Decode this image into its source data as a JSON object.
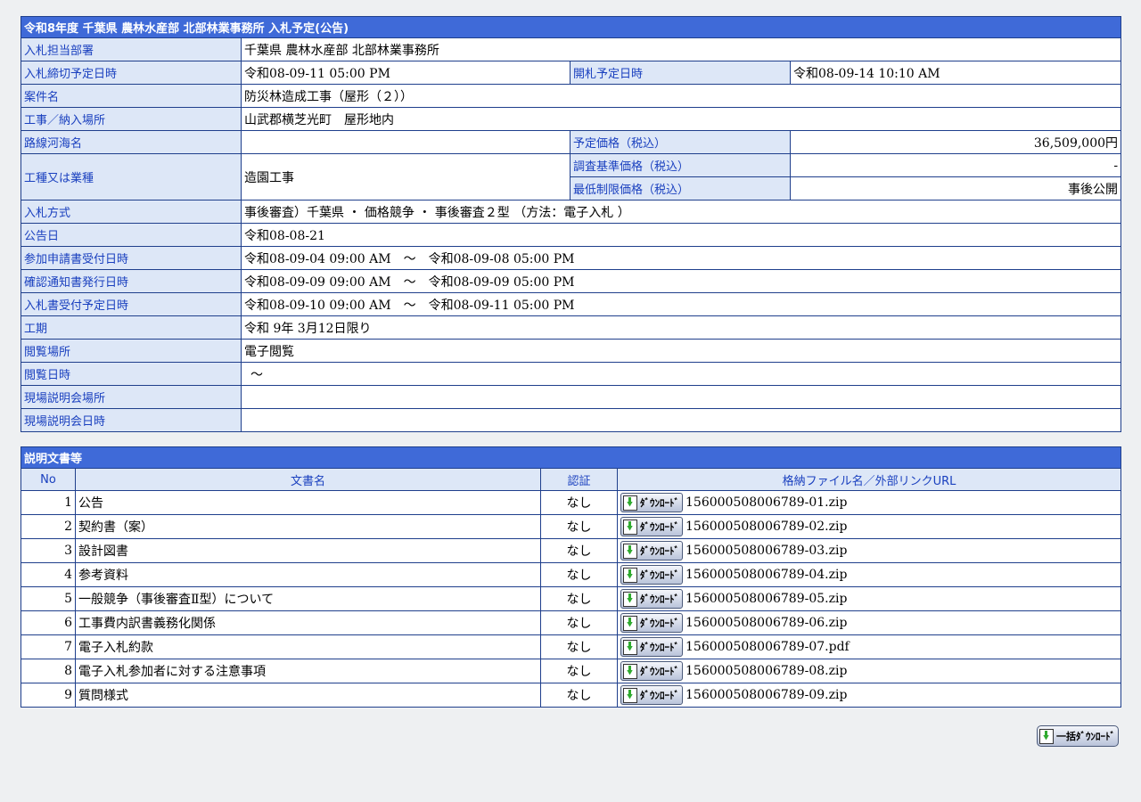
{
  "title": "令和8年度 千葉県 農林水産部 北部林業事務所 入札予定(公告)",
  "info": {
    "dept_label": "入札担当部署",
    "dept": "千葉県 農林水産部 北部林業事務所",
    "deadline_label": "入札締切予定日時",
    "deadline": "令和08-09-11 05:00 PM",
    "opening_label": "開札予定日時",
    "opening": "令和08-09-14 10:10 AM",
    "case_label": "案件名",
    "case": "防災林造成工事（屋形（２））",
    "place_label": "工事／納入場所",
    "place": "山武郡横芝光町　屋形地内",
    "route_label": "路線河海名",
    "route": "",
    "est_price_label": "予定価格（税込）",
    "est_price": "36,509,000円",
    "type_label": "工種又は業種",
    "type": "造園工事",
    "survey_price_label": "調査基準価格（税込）",
    "survey_price": "-",
    "min_price_label": "最低制限価格（税込）",
    "min_price": "事後公開",
    "method_label": "入札方式",
    "method": "事後審査）千葉県 ・ 価格競争 ・ 事後審査２型 （方法：電子入札 ）",
    "notice_label": "公告日",
    "notice": "令和08-08-21",
    "apply_label": "参加申請書受付日時",
    "apply": "令和08-09-04 09:00 AM　～　令和08-09-08 05:00 PM",
    "confirm_label": "確認通知書発行日時",
    "confirm": "令和08-09-09 09:00 AM　～　令和08-09-09 05:00 PM",
    "receive_label": "入札書受付予定日時",
    "receive": "令和08-09-10 09:00 AM　～　令和08-09-11 05:00 PM",
    "period_label": "工期",
    "period": "令和 9年 3月12日限り",
    "view_place_label": "閲覧場所",
    "view_place": "電子閲覧",
    "view_date_label": "閲覧日時",
    "view_date": "～",
    "site_place_label": "現場説明会場所",
    "site_place": "",
    "site_date_label": "現場説明会日時",
    "site_date": ""
  },
  "docs": {
    "title": "説明文書等",
    "headers": {
      "no": "No",
      "name": "文書名",
      "auth": "認証",
      "file": "格納ファイル名／外部リンクURL"
    },
    "download_label": "ﾀﾞｳﾝﾛｰﾄﾞ",
    "rows": [
      {
        "no": "1",
        "name": "公告",
        "auth": "なし",
        "file": "156000508006789-01.zip"
      },
      {
        "no": "2",
        "name": "契約書（案）",
        "auth": "なし",
        "file": "156000508006789-02.zip"
      },
      {
        "no": "3",
        "name": "設計図書",
        "auth": "なし",
        "file": "156000508006789-03.zip"
      },
      {
        "no": "4",
        "name": "参考資料",
        "auth": "なし",
        "file": "156000508006789-04.zip"
      },
      {
        "no": "5",
        "name": "一般競争（事後審査Ⅱ型）について",
        "auth": "なし",
        "file": "156000508006789-05.zip"
      },
      {
        "no": "6",
        "name": "工事費内訳書義務化関係",
        "auth": "なし",
        "file": "156000508006789-06.zip"
      },
      {
        "no": "7",
        "name": "電子入札約款",
        "auth": "なし",
        "file": "156000508006789-07.pdf"
      },
      {
        "no": "8",
        "name": "電子入札参加者に対する注意事項",
        "auth": "なし",
        "file": "156000508006789-08.zip"
      },
      {
        "no": "9",
        "name": "質問様式",
        "auth": "なし",
        "file": "156000508006789-09.zip"
      }
    ]
  },
  "bulk_download_label": "一括ﾀﾞｳﾝﾛｰﾄﾞ",
  "icons": {
    "download": "download-icon"
  },
  "colors": {
    "header_bg": "#3f6ad8",
    "label_bg": "#dde7f7",
    "label_text": "#1a40bf",
    "border": "#1f3f8c"
  }
}
